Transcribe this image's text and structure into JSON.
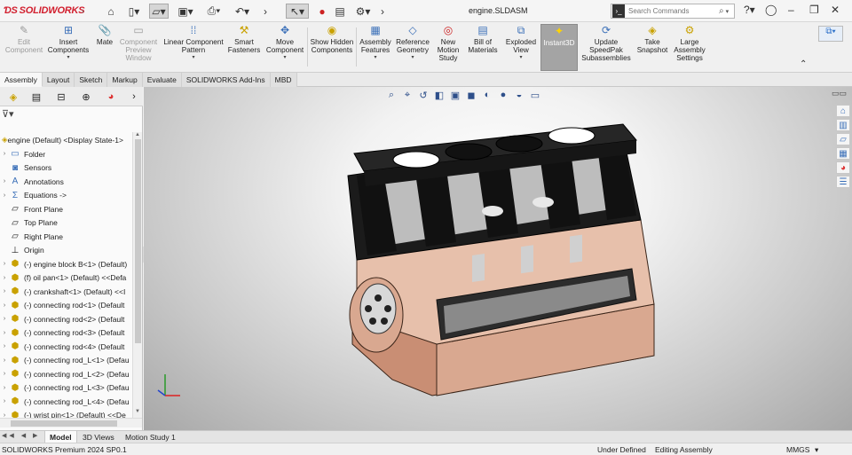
{
  "titlebar": {
    "app_name": "SOLIDWORKS",
    "document_title": "engine.SLDASM",
    "search_placeholder": "Search Commands"
  },
  "ribbon": {
    "buttons": [
      {
        "label": "Edit Component",
        "icon": "edit-component-icon",
        "enabled": false
      },
      {
        "label": "Insert Components",
        "icon": "insert-components-icon",
        "enabled": true
      },
      {
        "label": "Mate",
        "icon": "mate-icon",
        "enabled": true
      },
      {
        "label": "Component Preview Window",
        "icon": "component-preview-icon",
        "enabled": false
      },
      {
        "label": "Linear Component Pattern",
        "icon": "linear-pattern-icon",
        "enabled": true
      },
      {
        "label": "Smart Fasteners",
        "icon": "smart-fasteners-icon",
        "enabled": true
      },
      {
        "label": "Move Component",
        "icon": "move-component-icon",
        "enabled": true
      },
      {
        "label": "Show Hidden Components",
        "icon": "show-hidden-icon",
        "enabled": true
      },
      {
        "label": "Assembly Features",
        "icon": "assembly-features-icon",
        "enabled": true
      },
      {
        "label": "Reference Geometry",
        "icon": "reference-geometry-icon",
        "enabled": true
      },
      {
        "label": "New Motion Study",
        "icon": "motion-study-icon",
        "enabled": true
      },
      {
        "label": "Bill of Materials",
        "icon": "bom-icon",
        "enabled": true
      },
      {
        "label": "Exploded View",
        "icon": "exploded-view-icon",
        "enabled": true
      },
      {
        "label": "Instant3D",
        "icon": "instant3d-icon",
        "enabled": true,
        "active": true
      },
      {
        "label": "Update SpeedPak Subassemblies",
        "icon": "speedpak-icon",
        "enabled": true
      },
      {
        "label": "Take Snapshot",
        "icon": "snapshot-icon",
        "enabled": true
      },
      {
        "label": "Large Assembly Settings",
        "icon": "large-assembly-icon",
        "enabled": true
      }
    ]
  },
  "tabs": [
    "Assembly",
    "Layout",
    "Sketch",
    "Markup",
    "Evaluate",
    "SOLIDWORKS Add-Ins",
    "MBD"
  ],
  "tree": {
    "root": "engine (Default) <Display State-1>",
    "items": [
      {
        "label": "Folder",
        "icon": "folder-icon",
        "expandable": true
      },
      {
        "label": "Sensors",
        "icon": "sensors-icon",
        "expandable": false
      },
      {
        "label": "Annotations",
        "icon": "annotations-icon",
        "expandable": true
      },
      {
        "label": "Equations ->",
        "icon": "equations-icon",
        "expandable": true
      },
      {
        "label": "Front Plane",
        "icon": "plane-icon",
        "expandable": false
      },
      {
        "label": "Top Plane",
        "icon": "plane-icon",
        "expandable": false
      },
      {
        "label": "Right Plane",
        "icon": "plane-icon",
        "expandable": false
      },
      {
        "label": "Origin",
        "icon": "origin-icon",
        "expandable": false
      },
      {
        "label": "(-) engine block B<1> (Default)",
        "icon": "part-icon",
        "expandable": true
      },
      {
        "label": "(f) oil pan<1> (Default) <<Defa",
        "icon": "part-icon",
        "expandable": true
      },
      {
        "label": "(-) crankshaft<1> (Default) <<I",
        "icon": "part-icon",
        "expandable": true
      },
      {
        "label": "(-) connecting rod<1> (Default",
        "icon": "part-icon",
        "expandable": true
      },
      {
        "label": "(-) connecting rod<2> (Default",
        "icon": "part-icon",
        "expandable": true
      },
      {
        "label": "(-) connecting rod<3> (Default",
        "icon": "part-icon",
        "expandable": true
      },
      {
        "label": "(-) connecting rod<4> (Default",
        "icon": "part-icon",
        "expandable": true
      },
      {
        "label": "(-) connecting rod_L<1> (Defau",
        "icon": "part-icon",
        "expandable": true
      },
      {
        "label": "(-) connecting rod_L<2> (Defau",
        "icon": "part-icon",
        "expandable": true
      },
      {
        "label": "(-) connecting rod_L<3> (Defau",
        "icon": "part-icon",
        "expandable": true
      },
      {
        "label": "(-) connecting rod_L<4> (Defau",
        "icon": "part-icon",
        "expandable": true
      },
      {
        "label": "(-) wrist pin<1> (Default) <<De",
        "icon": "part-icon",
        "expandable": true
      }
    ]
  },
  "bottom_tabs": [
    "Model",
    "3D Views",
    "Motion Study 1"
  ],
  "status": {
    "version": "SOLIDWORKS Premium 2024 SP0.1",
    "definition": "Under Defined",
    "mode": "Editing Assembly",
    "units": "MMGS"
  },
  "colors": {
    "brand": "#d2202f",
    "engine_block": "#1a1a1a",
    "oil_pan": "#d9a890"
  }
}
